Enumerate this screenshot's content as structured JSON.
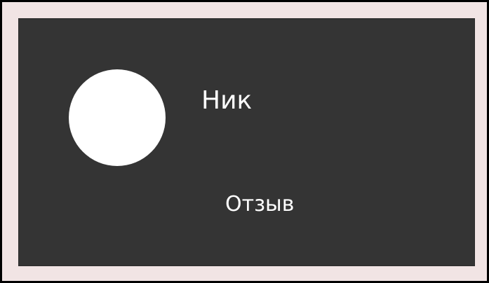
{
  "colors": {
    "outer_border": "#000000",
    "frame_background": "#f1e4e4",
    "card_background": "#343434",
    "avatar_fill": "#ffffff",
    "text": "#ffffff"
  },
  "review_card": {
    "nick": "Ник",
    "review": "Отзыв",
    "avatar_icon": "avatar-placeholder"
  }
}
